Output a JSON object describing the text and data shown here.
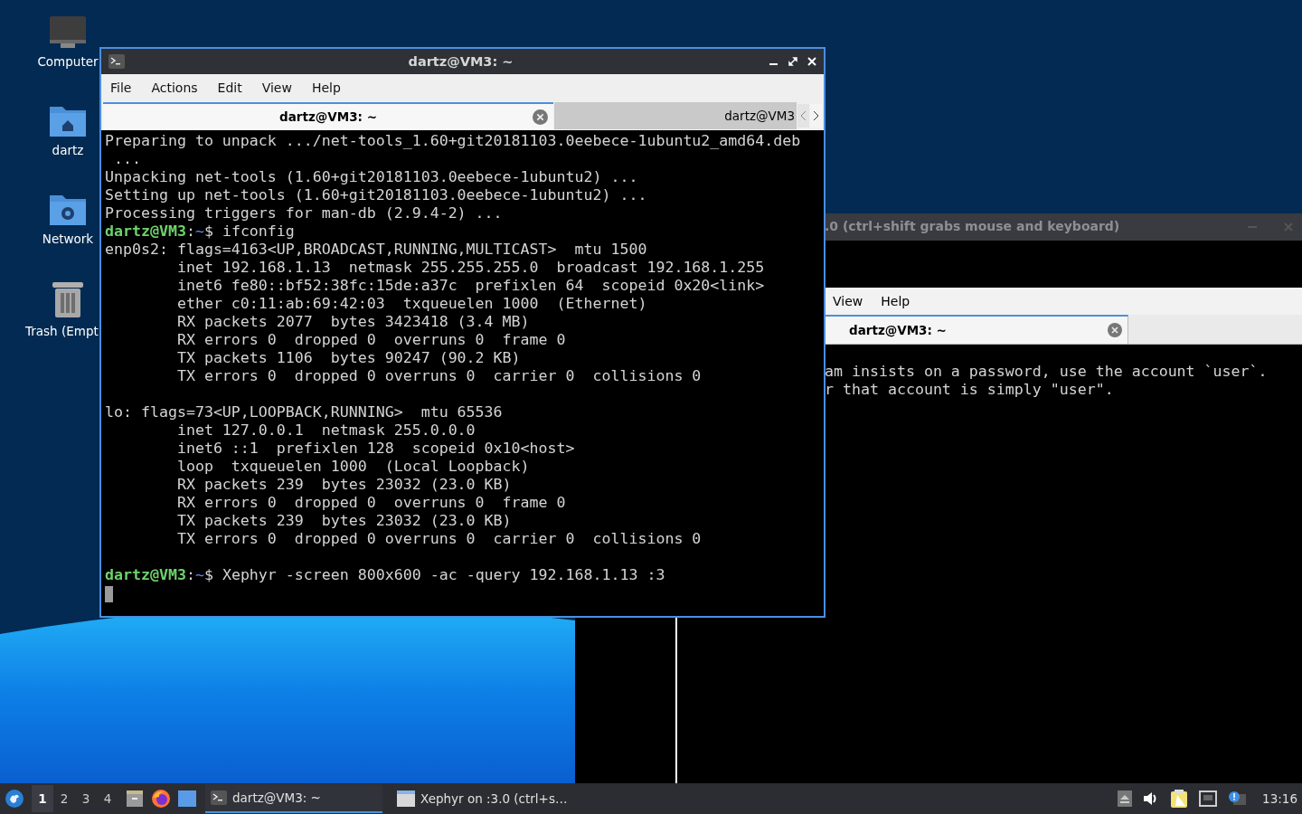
{
  "desktop": {
    "icons": [
      {
        "kind": "computer",
        "label": "Computer"
      },
      {
        "kind": "home-folder",
        "label": "dartz"
      },
      {
        "kind": "network-folder",
        "label": "Network"
      },
      {
        "kind": "trash",
        "label": "Trash (Empt"
      }
    ]
  },
  "xephyr_window": {
    "title": ".0 (ctrl+shift grabs mouse and keyboard)",
    "menu": [
      "View",
      "Help"
    ],
    "tabs": [
      {
        "label": "dartz@VM3: ~",
        "selected": true
      }
    ],
    "lines": [
      "am insists on a password, use the account `user`.",
      "r that account is simply \"user\"."
    ]
  },
  "terminal_window": {
    "title": "dartz@VM3: ~",
    "menu": [
      "File",
      "Actions",
      "Edit",
      "View",
      "Help"
    ],
    "tabs": [
      {
        "label": "dartz@VM3: ~",
        "selected": true
      },
      {
        "label": "dartz@VM3",
        "selected": false
      }
    ],
    "lines": [
      {
        "kind": "output",
        "text": "Preparing to unpack .../net-tools_1.60+git20181103.0eebece-1ubuntu2_amd64.deb"
      },
      {
        "kind": "output",
        "text": " ..."
      },
      {
        "kind": "output",
        "text": "Unpacking net-tools (1.60+git20181103.0eebece-1ubuntu2) ..."
      },
      {
        "kind": "output",
        "text": "Setting up net-tools (1.60+git20181103.0eebece-1ubuntu2) ..."
      },
      {
        "kind": "output",
        "text": "Processing triggers for man-db (2.9.4-2) ..."
      },
      {
        "kind": "prompt",
        "host": "dartz@VM3",
        "sep": ":",
        "path": "~",
        "command": "$ ifconfig"
      },
      {
        "kind": "output",
        "text": "enp0s2: flags=4163<UP,BROADCAST,RUNNING,MULTICAST>  mtu 1500"
      },
      {
        "kind": "output",
        "text": "        inet 192.168.1.13  netmask 255.255.255.0  broadcast 192.168.1.255"
      },
      {
        "kind": "output",
        "text": "        inet6 fe80::bf52:38fc:15de:a37c  prefixlen 64  scopeid 0x20<link>"
      },
      {
        "kind": "output",
        "text": "        ether c0:11:ab:69:42:03  txqueuelen 1000  (Ethernet)"
      },
      {
        "kind": "output",
        "text": "        RX packets 2077  bytes 3423418 (3.4 MB)"
      },
      {
        "kind": "output",
        "text": "        RX errors 0  dropped 0  overruns 0  frame 0"
      },
      {
        "kind": "output",
        "text": "        TX packets 1106  bytes 90247 (90.2 KB)"
      },
      {
        "kind": "output",
        "text": "        TX errors 0  dropped 0 overruns 0  carrier 0  collisions 0"
      },
      {
        "kind": "blank"
      },
      {
        "kind": "output",
        "text": "lo: flags=73<UP,LOOPBACK,RUNNING>  mtu 65536"
      },
      {
        "kind": "output",
        "text": "        inet 127.0.0.1  netmask 255.0.0.0"
      },
      {
        "kind": "output",
        "text": "        inet6 ::1  prefixlen 128  scopeid 0x10<host>"
      },
      {
        "kind": "output",
        "text": "        loop  txqueuelen 1000  (Local Loopback)"
      },
      {
        "kind": "output",
        "text": "        RX packets 239  bytes 23032 (23.0 KB)"
      },
      {
        "kind": "output",
        "text": "        RX errors 0  dropped 0  overruns 0  frame 0"
      },
      {
        "kind": "output",
        "text": "        TX packets 239  bytes 23032 (23.0 KB)"
      },
      {
        "kind": "output",
        "text": "        TX errors 0  dropped 0 overruns 0  carrier 0  collisions 0"
      },
      {
        "kind": "blank"
      },
      {
        "kind": "prompt",
        "host": "dartz@VM3",
        "sep": ":",
        "path": "~",
        "command": "$ Xephyr -screen 800x600 -ac -query 192.168.1.13 :3"
      },
      {
        "kind": "cursor"
      }
    ]
  },
  "taskbar": {
    "workspaces": [
      {
        "label": "1",
        "selected": true
      },
      {
        "label": "2",
        "selected": false
      },
      {
        "label": "3",
        "selected": false
      },
      {
        "label": "4",
        "selected": false
      }
    ],
    "tasks": [
      {
        "kind": "terminal",
        "label": "dartz@VM3: ~",
        "selected": true
      },
      {
        "kind": "window",
        "label": "Xephyr on :3.0 (ctrl+s…",
        "selected": false
      }
    ],
    "clock": "13:16"
  }
}
